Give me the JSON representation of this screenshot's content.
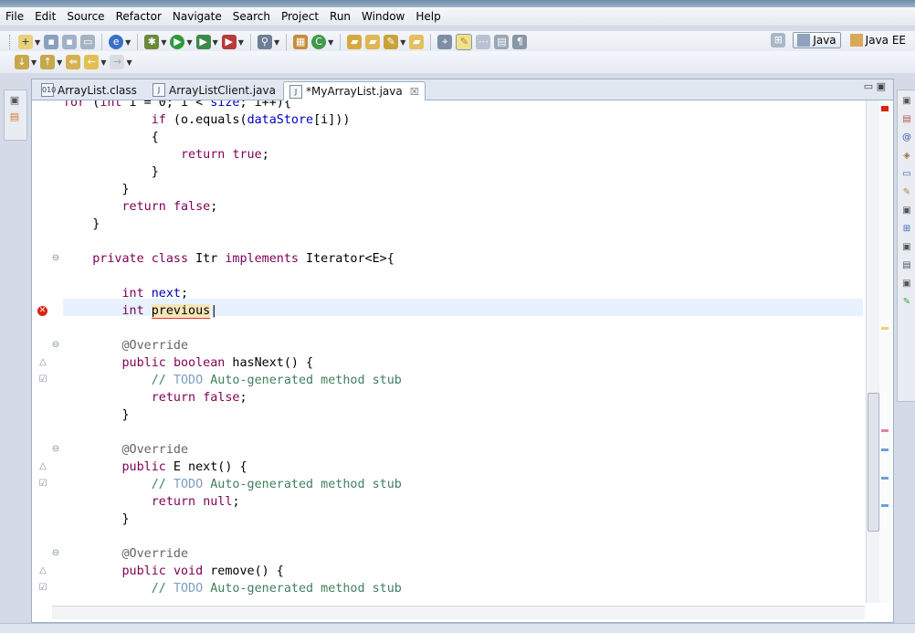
{
  "menu": [
    "File",
    "Edit",
    "Source",
    "Refactor",
    "Navigate",
    "Search",
    "Project",
    "Run",
    "Window",
    "Help"
  ],
  "perspectives": [
    {
      "label": "Java",
      "active": true
    },
    {
      "label": "Java EE",
      "active": false
    }
  ],
  "tabs": [
    {
      "label": "ArrayList.class",
      "icon": "class-file-icon",
      "active": false
    },
    {
      "label": "ArrayListClient.java",
      "icon": "java-file-icon",
      "active": false
    },
    {
      "label": "*MyArrayList.java",
      "icon": "java-file-icon",
      "active": true
    }
  ],
  "code_lines": [
    "        for (int i = 0; i < size; i++){",
    "            if (o.equals(dataStore[i]))",
    "            {",
    "                return true;",
    "            }",
    "        }",
    "        return false;",
    "    }",
    "",
    "    private class Itr implements Iterator<E>{",
    "",
    "        int next;",
    "        int previous",
    "",
    "        @Override",
    "        public boolean hasNext() {",
    "            // TODO Auto-generated method stub",
    "            return false;",
    "        }",
    "",
    "        @Override",
    "        public E next() {",
    "            // TODO Auto-generated method stub",
    "            return null;",
    "        }",
    "",
    "        @Override",
    "        public void remove() {",
    "            // TODO Auto-generated method stub"
  ],
  "colors": {
    "keyword": "#7f0055",
    "field": "#0000c0",
    "comment": "#3f7f5f",
    "todo": "#7f9fbf",
    "current_line": "#e8f2fe",
    "error": "#dd2211"
  }
}
